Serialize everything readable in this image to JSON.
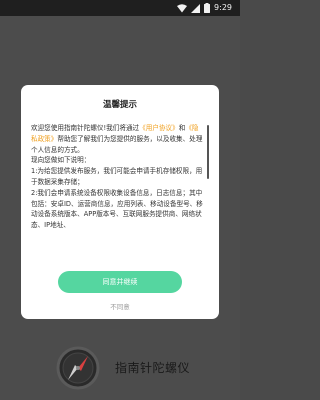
{
  "status": {
    "time": "9:29"
  },
  "dialog": {
    "title": "温馨提示",
    "intro_a": "欢迎您使用指南针陀螺仪!我们将通过",
    "user_agreement": "《用户协议》",
    "and": "和",
    "privacy_policy": "《隐私政策》",
    "intro_b": "帮助您了解我们为您提供的服务，以及收集、处理个人信息的方式。",
    "line2": "现向您做如下说明：",
    "item1": "1:为给您提供发布服务，我们可能会申请手机存储权限，用于数据采集存储；",
    "item2": "2:我们会申请系统设备权限收集设备信息，日志信息；其中包括：安卓ID、运营商信息，应用列表、移动设备型号、移动设备系统版本、APP版本号、互联网服务提供商、网络状态、IP地址、",
    "agree_label": "同意并继续",
    "disagree_label": "不同意"
  },
  "app": {
    "name": "指南针陀螺仪"
  }
}
